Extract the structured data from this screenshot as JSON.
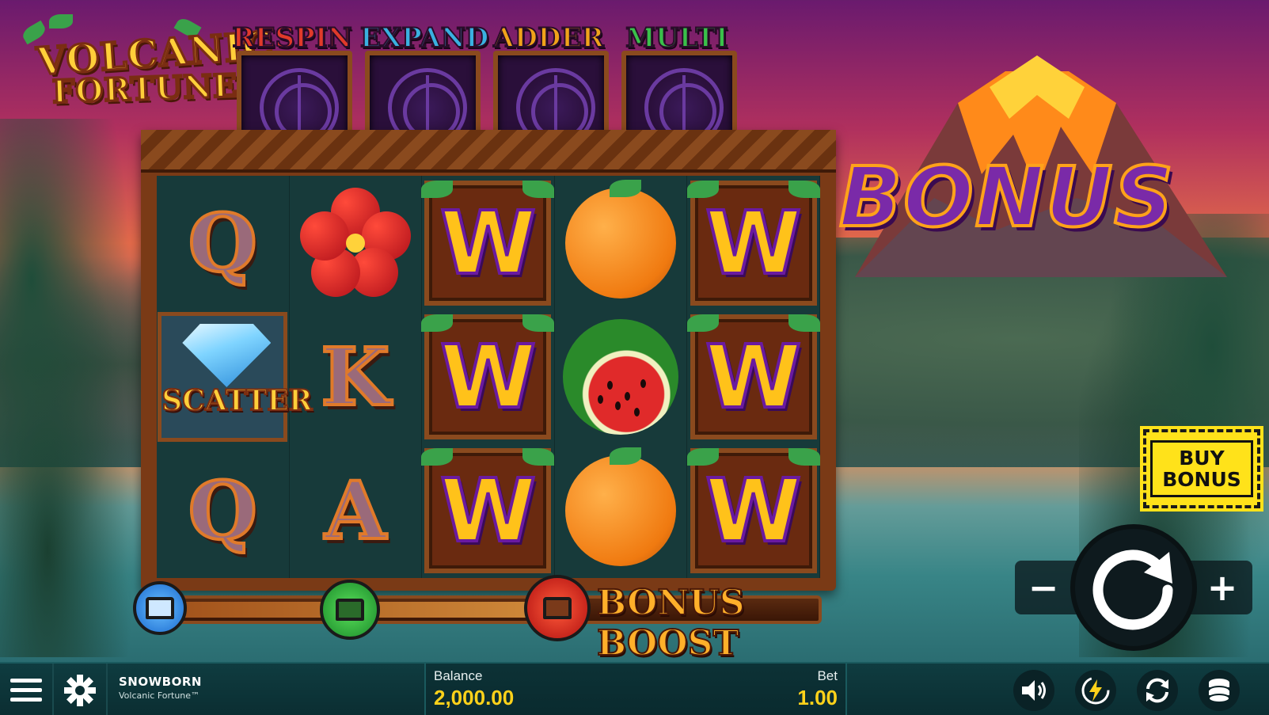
{
  "game": {
    "logo_line1": "VOLCANIC",
    "logo_line2": "FORTUNE™"
  },
  "features": [
    {
      "label": "RESPIN",
      "color": "#e03a2a"
    },
    {
      "label": "EXPAND",
      "color": "#3ab0e0"
    },
    {
      "label": "ADDER",
      "color": "#f0a21a"
    },
    {
      "label": "MULTI",
      "color": "#3ac04a"
    }
  ],
  "reels": {
    "rows": [
      [
        "Q",
        "hibiscus",
        "W",
        "orange",
        "W"
      ],
      [
        "scatter",
        "K",
        "W",
        "watermelon",
        "W"
      ],
      [
        "Q",
        "A",
        "W",
        "orange",
        "W"
      ]
    ],
    "scatter_label": "SCATTER",
    "wild_label": "W"
  },
  "bonus_banner": "BONUS",
  "bonus_meter": {
    "label": "BONUS BOOST",
    "chests": [
      "blue-chest-icon",
      "green-chest-icon",
      "red-chest-icon"
    ]
  },
  "buy_bonus": {
    "line1": "BUY",
    "line2": "BONUS"
  },
  "controls": {
    "minus": "−",
    "plus": "+",
    "spin_icon": "spin-arrow-icon"
  },
  "bottom_bar": {
    "brand_name": "SNOWBORN",
    "game_name": "Volcanic Fortune™",
    "balance_label": "Balance",
    "balance_value": "2,000.00",
    "bet_label": "Bet",
    "bet_value": "1.00",
    "icons": [
      "menu-icon",
      "snowflake-icon",
      "sound-icon",
      "turbo-icon",
      "autoplay-icon",
      "coins-icon"
    ]
  },
  "colors": {
    "gold": "#ffd21a",
    "wild_purple": "#6a1aa0",
    "frame_wood": "#7a3a16"
  }
}
